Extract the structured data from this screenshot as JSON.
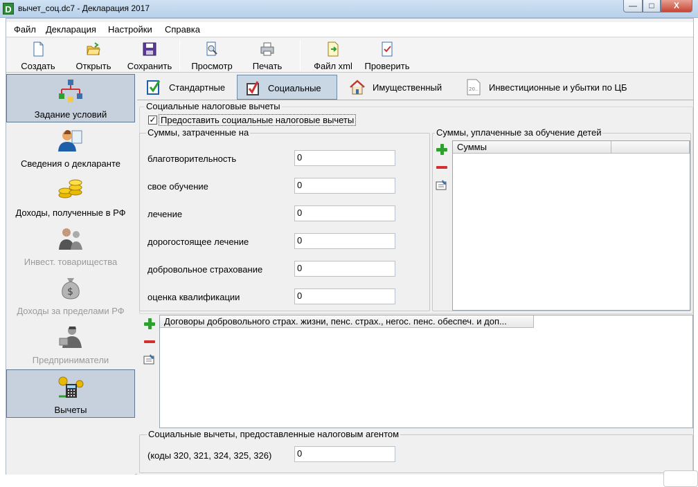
{
  "window": {
    "title": "вычет_соц.dc7 - Декларация 2017",
    "logo_letter": "D",
    "min_glyph": "—",
    "max_glyph": "□",
    "close_glyph": "X"
  },
  "menu": [
    "Файл",
    "Декларация",
    "Настройки",
    "Справка"
  ],
  "toolbar": [
    {
      "label": "Создать",
      "icon": "new-document-icon"
    },
    {
      "label": "Открыть",
      "icon": "open-folder-icon"
    },
    {
      "label": "Сохранить",
      "icon": "save-disk-icon"
    },
    {
      "label": "Просмотр",
      "icon": "preview-icon"
    },
    {
      "label": "Печать",
      "icon": "printer-icon"
    },
    {
      "label": "Файл xml",
      "icon": "xml-export-icon"
    },
    {
      "label": "Проверить",
      "icon": "check-document-icon"
    }
  ],
  "sidebar": [
    {
      "label": "Задание условий",
      "selected": true,
      "disabled": false
    },
    {
      "label": "Сведения о декларанте",
      "selected": false,
      "disabled": false
    },
    {
      "label": "Доходы, полученные в РФ",
      "selected": false,
      "disabled": false
    },
    {
      "label": "Инвест. товарищества",
      "selected": false,
      "disabled": true
    },
    {
      "label": "Доходы за пределами РФ",
      "selected": false,
      "disabled": true
    },
    {
      "label": "Предприниматели",
      "selected": false,
      "disabled": true
    },
    {
      "label": "Вычеты",
      "selected": true,
      "disabled": false
    }
  ],
  "tabs": [
    {
      "label": "Стандартные",
      "selected": false
    },
    {
      "label": "Социальные",
      "selected": true
    },
    {
      "label": "Имущественный",
      "selected": false
    },
    {
      "label": "Инвестиционные и убытки по ЦБ",
      "selected": false,
      "icon_text": "20.."
    }
  ],
  "social": {
    "group_title": "Социальные налоговые вычеты",
    "checkbox_label": "Предоставить социальные налоговые вычеты",
    "checked": true,
    "check_glyph": "✓",
    "spent_title": "Суммы, затраченные на",
    "fields": [
      {
        "label": "благотворительность",
        "value": "0"
      },
      {
        "label": "свое обучение",
        "value": "0"
      },
      {
        "label": "лечение",
        "value": "0"
      },
      {
        "label": "дорогостоящее лечение",
        "value": "0"
      },
      {
        "label": "добровольное страхование",
        "value": "0"
      },
      {
        "label": "оценка квалификации",
        "value": "0"
      }
    ],
    "children_title": "Суммы, уплаченные за обучение детей",
    "children_column": "Суммы",
    "contracts_column": "Договоры добровольного страх. жизни, пенс. страх., негос. пенс. обеспеч. и доп...",
    "agent_title": "Социальные вычеты, предоставленные налоговым агентом",
    "agent_label": "(коды 320, 321, 324, 325, 326)",
    "agent_value": "0"
  }
}
